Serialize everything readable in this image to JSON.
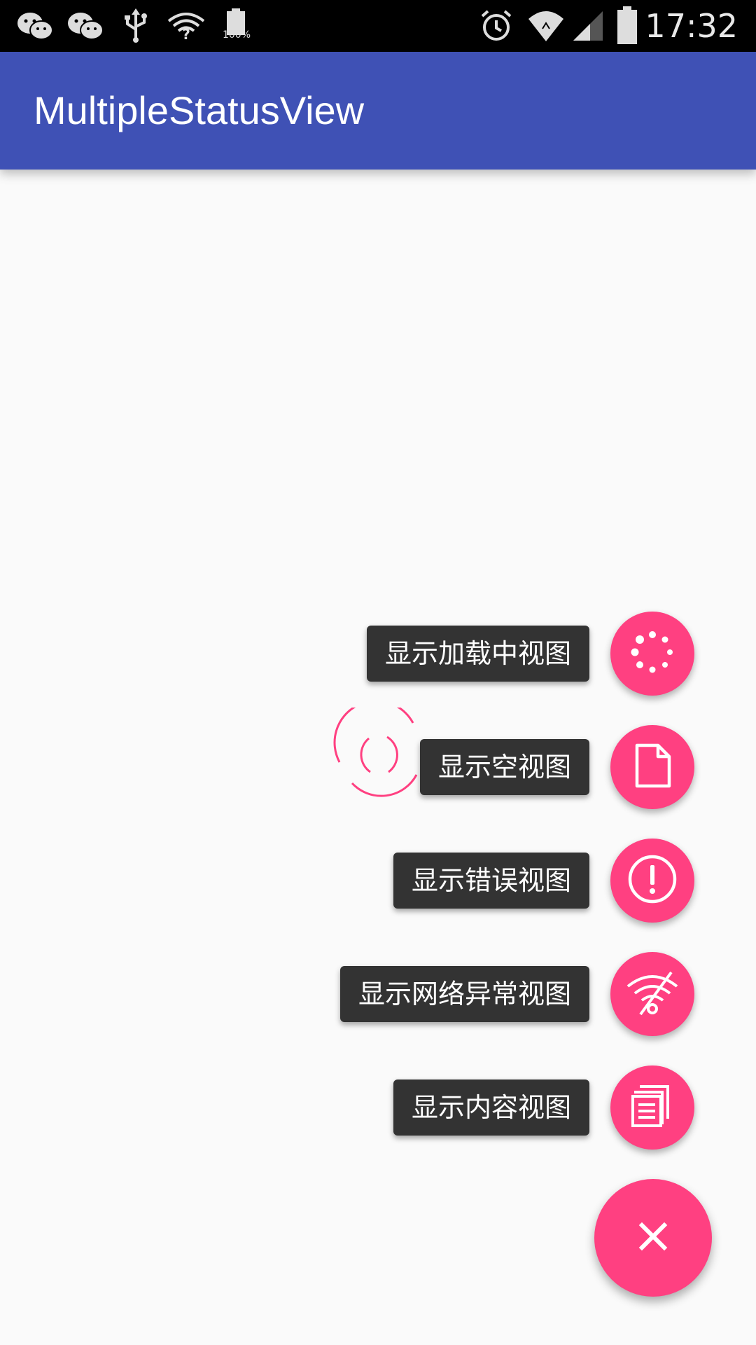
{
  "status_bar": {
    "time": "17:32",
    "battery_level_label": "100%",
    "left_icons": [
      "wechat-icon",
      "wechat-icon",
      "usb-icon",
      "wifi-question-icon",
      "battery-icon"
    ],
    "right_icons": [
      "alarm-icon",
      "wifi-icon",
      "cell-signal-icon",
      "battery-icon"
    ]
  },
  "app_bar": {
    "title": "MultipleStatusView",
    "color": "#3f51b5"
  },
  "fab_menu": {
    "accent_color": "#ff4081",
    "label_background": "#333333",
    "items": [
      {
        "label": "显示加载中视图",
        "icon": "loading-dots-icon"
      },
      {
        "label": "显示空视图",
        "icon": "empty-document-icon"
      },
      {
        "label": "显示错误视图",
        "icon": "error-icon"
      },
      {
        "label": "显示网络异常视图",
        "icon": "wifi-off-icon"
      },
      {
        "label": "显示内容视图",
        "icon": "content-pages-icon"
      }
    ],
    "main_button_icon": "close-icon"
  },
  "loading_indicator": {
    "icon": "spinner-icon"
  }
}
